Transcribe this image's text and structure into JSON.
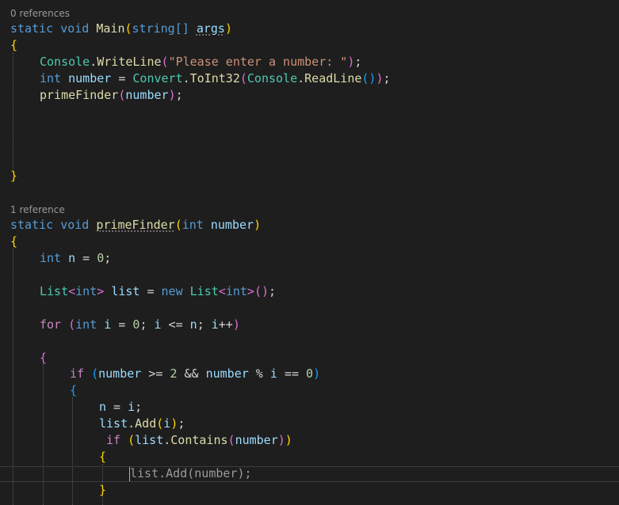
{
  "code_lens": {
    "main": "0 references",
    "prime": "1 reference"
  },
  "tokens": {
    "static": "static",
    "void": "void",
    "main_name": "Main",
    "lparen": "(",
    "rparen": ")",
    "string_arr": "string[]",
    "args": "args",
    "lbrace": "{",
    "rbrace": "}",
    "console": "Console",
    "dot": ".",
    "writeline": "WriteLine",
    "prompt_literal": "\"Please enter a number: \"",
    "close_stmt": ");",
    "int": "int",
    "number": "number",
    "eq": " = ",
    "convert": "Convert",
    "toint32": "ToInt32",
    "readline": "ReadLine",
    "empty_call": "()",
    "close_stmt2": "));",
    "primefinder": "primeFinder",
    "n": "n",
    "zero": "0",
    "semi": ";",
    "list_type": "List",
    "lt": "<",
    "gt": ">",
    "list_var": "list",
    "new": "new",
    "new_close": "();",
    "for": "for",
    "i": "i",
    "zero_semi": "; ",
    "lte": " <= ",
    "semi_sp": "; ",
    "inc": "++",
    "if": "if",
    "gte": " >= ",
    "two": "2",
    "and": " && ",
    "mod": " % ",
    "eqeq": " == ",
    "add": "Add",
    "contains": "Contains",
    "ghost_line": "list.Add(number);"
  }
}
